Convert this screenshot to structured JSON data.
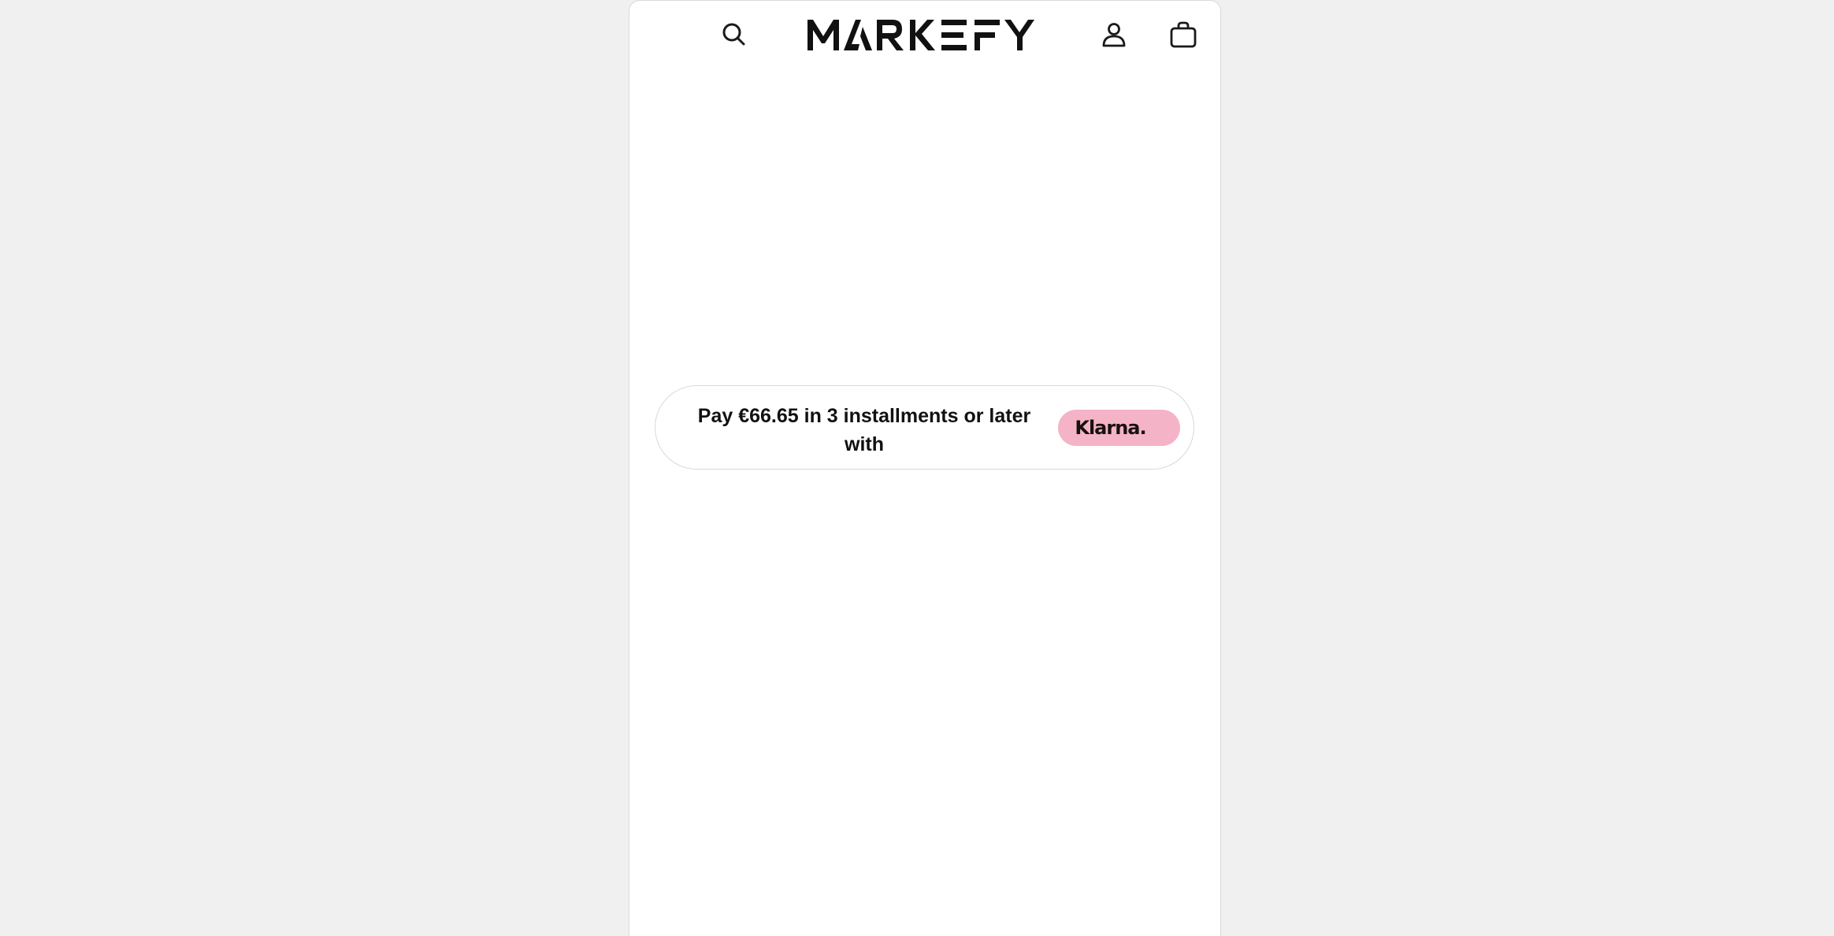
{
  "header": {
    "logo_text": "MARKEFY",
    "icons": {
      "search": "search-icon",
      "account": "user-icon",
      "cart": "shopping-bag-icon"
    }
  },
  "klarna": {
    "message": "Pay €66.65 in 3 installments or later with",
    "badge_label": "Klarna.",
    "badge_color": "#f5b3c8"
  },
  "colors": {
    "page_background": "#f0f0f0",
    "panel_background": "#ffffff",
    "text": "#111111"
  }
}
